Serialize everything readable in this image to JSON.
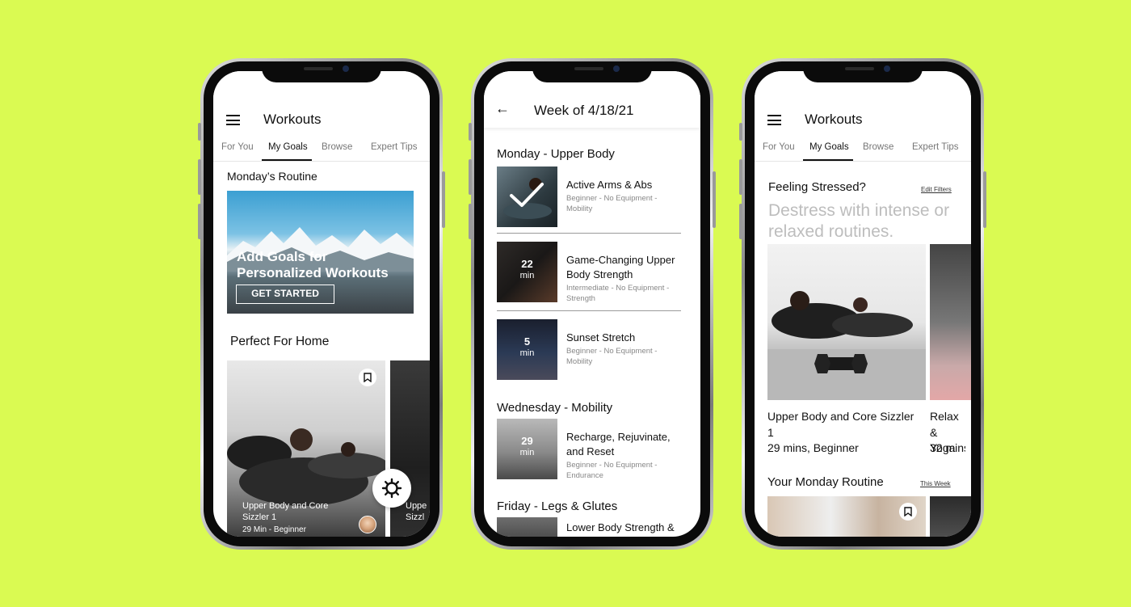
{
  "background_color": "#dafa52",
  "phone1": {
    "app_title": "Workouts",
    "tabs": [
      {
        "label": "For You",
        "active": false
      },
      {
        "label": "My Goals",
        "active": true
      },
      {
        "label": "Browse",
        "active": false
      },
      {
        "label": "Expert Tips",
        "active": false
      }
    ],
    "routine_title": "Monday’s Routine",
    "hero_headline_1": "Add Goals for",
    "hero_headline_2": "Personalized Workouts",
    "hero_button": "GET STARTED",
    "section_title": "Perfect For Home",
    "card_title_1": "Upper Body and Core",
    "card_title_2": "Sizzler 1",
    "card_meta": "29  Min - Beginner",
    "card_b_title_1": "Uppe",
    "card_b_title_2": "Sizzl"
  },
  "phone2": {
    "app_title": "Week of 4/18/21",
    "days": [
      {
        "title": "Monday - Upper Body"
      },
      {
        "title": "Wednesday - Mobility"
      },
      {
        "title": "Friday - Legs & Glutes"
      }
    ],
    "workouts": [
      {
        "title": "Active Arms & Abs",
        "meta": "Beginner - No Equipment - Mobility",
        "duration": "",
        "unit": "",
        "completed": true
      },
      {
        "title": "Game-Changing Upper Body Strength",
        "meta": "Intermediate - No Equipment - Strength",
        "duration": "22",
        "unit": "min",
        "completed": false
      },
      {
        "title": "Sunset Stretch",
        "meta": "Beginner - No Equipment - Mobility",
        "duration": "5",
        "unit": "min",
        "completed": false
      },
      {
        "title": "Recharge, Rejuvinate, and Reset",
        "meta": "Beginner - No Equipment - Endurance",
        "duration": "29",
        "unit": "min",
        "completed": false
      },
      {
        "title": "Lower Body Strength &",
        "meta": "",
        "duration": "",
        "unit": "",
        "completed": false
      }
    ]
  },
  "phone3": {
    "app_title": "Workouts",
    "tabs": [
      {
        "label": "For You",
        "active": false
      },
      {
        "label": "My Goals",
        "active": true
      },
      {
        "label": "Browse",
        "active": false
      },
      {
        "label": "Expert Tips",
        "active": false
      }
    ],
    "prompt_title": "Feeling Stressed?",
    "edit_filters": "Edit Filters",
    "subheading": "Destress with intense or relaxed routines.",
    "card_title": "Upper Body and Core Sizzler 1",
    "card_meta": "29 mins, Beginner",
    "card_b_title": "Relax & Yoga",
    "card_b_meta": "32 mins",
    "routine_title": "Your Monday Routine",
    "this_week": "This Week"
  }
}
